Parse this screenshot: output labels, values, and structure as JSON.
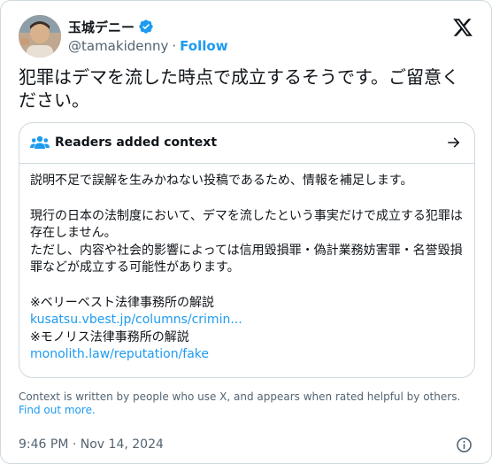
{
  "author": {
    "display_name": "玉城デニー",
    "handle": "@tamakidenny",
    "follow_label": "Follow",
    "separator": "·"
  },
  "tweet": {
    "text": "犯罪はデマを流した時点で成立するそうです。ご留意ください。"
  },
  "context": {
    "title": "Readers added context",
    "line1": "説明不足で誤解を生みかねない投稿であるため、情報を補足します。",
    "line2": "現行の日本の法制度において、デマを流したという事実だけで成立する犯罪は存在しません。",
    "line3": "ただし、内容や社会的影響によっては信用毀損罪・偽計業務妨害罪・名誉毀損罪などが成立する可能性があります。",
    "ref1_label": "※ベリーベスト法律事務所の解説",
    "ref1_link": "kusatsu.vbest.jp/columns/crimin...",
    "ref2_label": "※モノリス法律事務所の解説",
    "ref2_link": "monolith.law/reputation/fake"
  },
  "footnote": {
    "text": "Context is written by people who use X, and appears when rated helpful by others.",
    "link": "Find out more."
  },
  "timestamp": "9:46 PM · Nov 14, 2024",
  "colors": {
    "accent": "#1d9bf0",
    "text": "#0f1419",
    "muted": "#536471",
    "border": "#cfd9de"
  },
  "icons": [
    "verified-badge-icon",
    "x-logo-icon",
    "people-icon",
    "arrow-right-icon",
    "info-icon"
  ]
}
